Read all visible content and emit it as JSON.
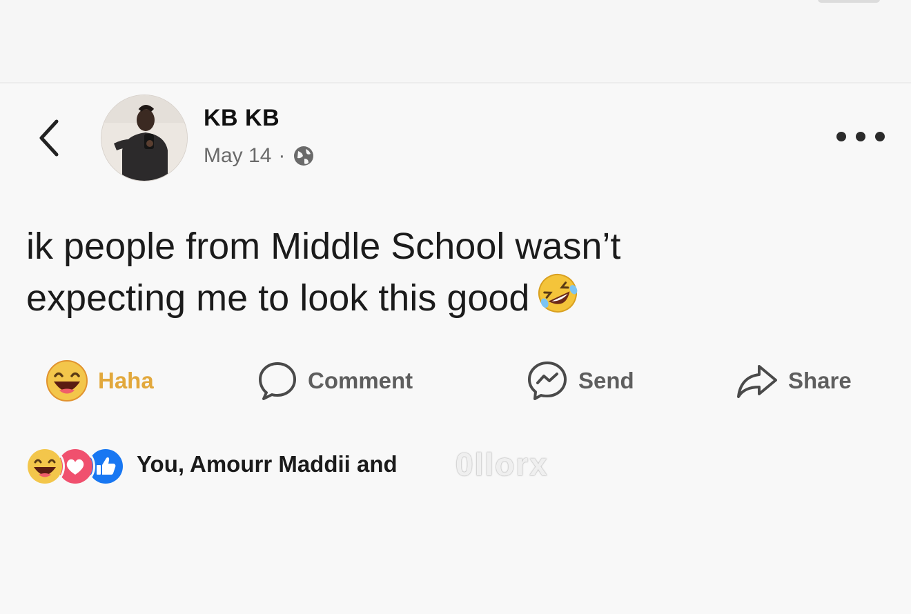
{
  "post": {
    "author": "KB KB",
    "date": "May 14",
    "separator": "·",
    "text_line1": "ik people from Middle School wasn’t",
    "text_line2": "expecting me to look this good",
    "text_emoji": "rolling-on-floor-laughing-emoji"
  },
  "actions": {
    "haha_label": "Haha",
    "comment_label": "Comment",
    "send_label": "Send",
    "share_label": "Share"
  },
  "reactions": {
    "summary": "You, Amourr Maddii and",
    "icons": [
      "haha-icon",
      "love-icon",
      "like-icon"
    ]
  },
  "watermark": "0llorx",
  "colors": {
    "haha": "#e2a83c",
    "love": "#f0506e",
    "like": "#1877f2",
    "text": "#1b1b1b",
    "muted": "#6a6a6a"
  }
}
